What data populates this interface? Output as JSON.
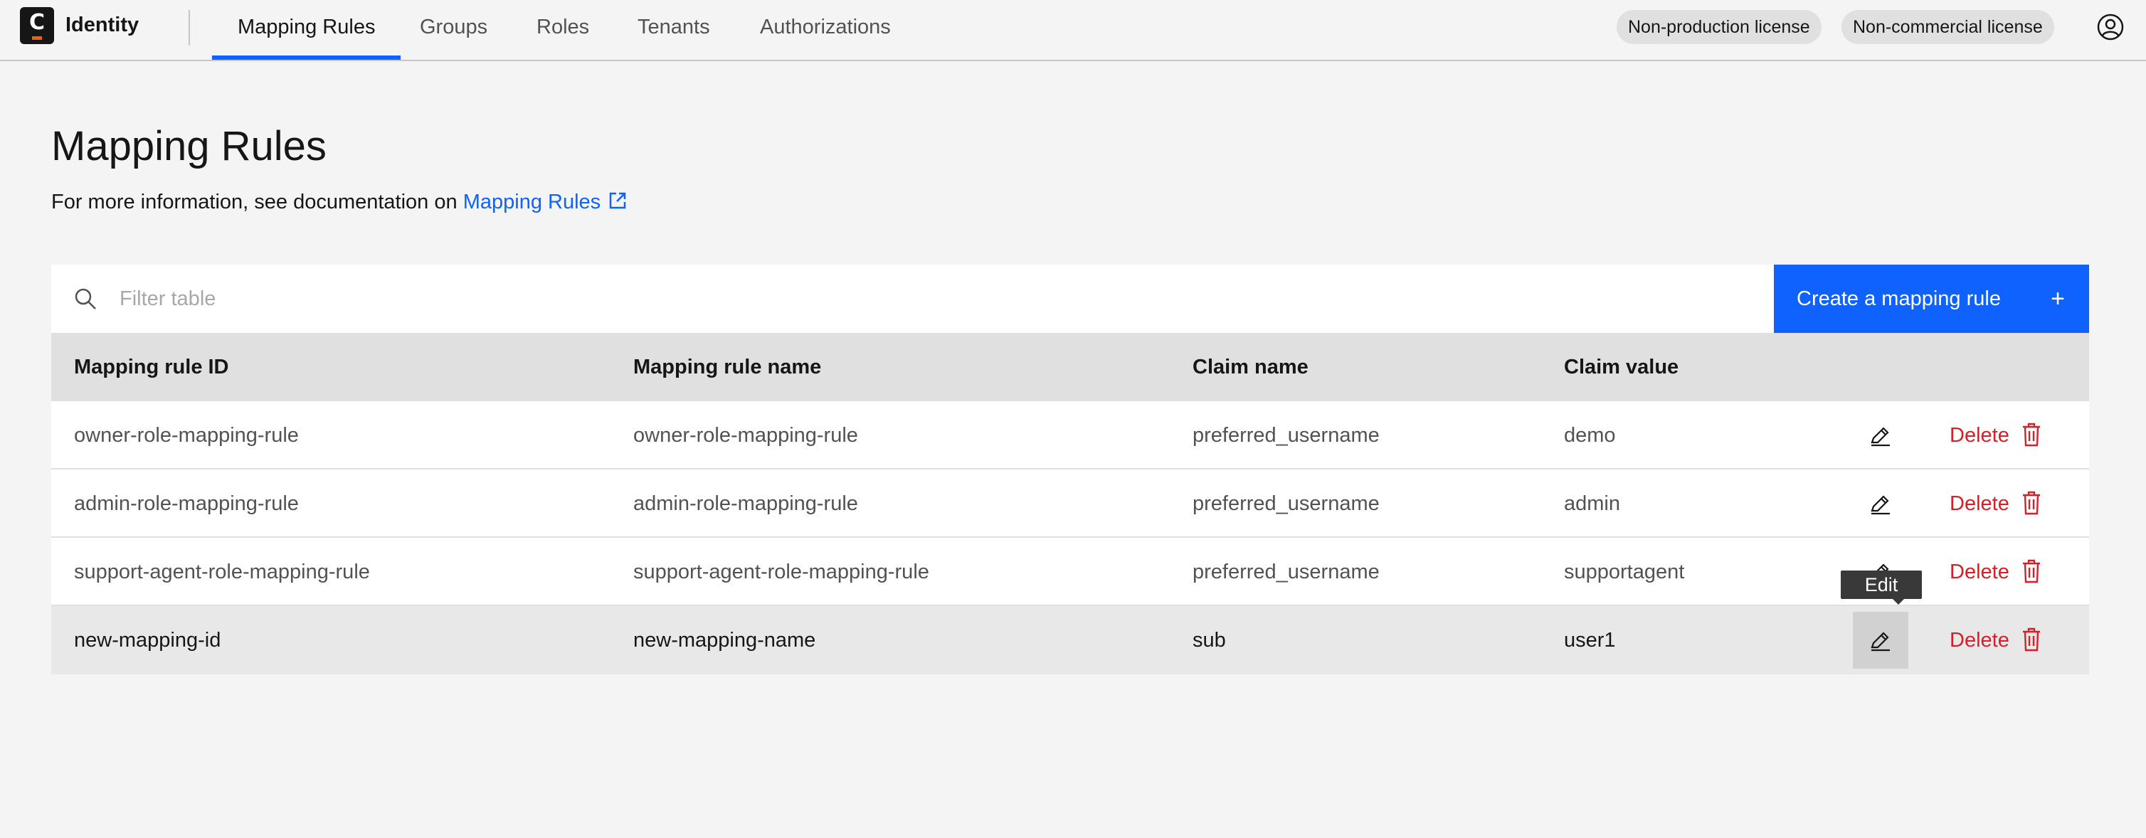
{
  "app": {
    "name": "Identity",
    "logo_letter": "C"
  },
  "nav": {
    "tabs": [
      {
        "label": "Mapping Rules",
        "active": true
      },
      {
        "label": "Groups",
        "active": false
      },
      {
        "label": "Roles",
        "active": false
      },
      {
        "label": "Tenants",
        "active": false
      },
      {
        "label": "Authorizations",
        "active": false
      }
    ]
  },
  "licenses": [
    "Non-production license",
    "Non-commercial license"
  ],
  "page": {
    "title": "Mapping Rules",
    "info_prefix": "For more information, see documentation on",
    "info_link": "Mapping Rules"
  },
  "toolbar": {
    "filter_placeholder": "Filter table",
    "create_label": "Create a mapping rule",
    "create_icon": "+"
  },
  "table": {
    "columns": [
      "Mapping rule ID",
      "Mapping rule name",
      "Claim name",
      "Claim value"
    ],
    "rows": [
      {
        "id": "owner-role-mapping-rule",
        "name": "owner-role-mapping-rule",
        "claim_name": "preferred_username",
        "claim_value": "demo",
        "delete_label": "Delete"
      },
      {
        "id": "admin-role-mapping-rule",
        "name": "admin-role-mapping-rule",
        "claim_name": "preferred_username",
        "claim_value": "admin",
        "delete_label": "Delete"
      },
      {
        "id": "support-agent-role-mapping-rule",
        "name": "support-agent-role-mapping-rule",
        "claim_name": "preferred_username",
        "claim_value": "supportagent",
        "delete_label": "Delete"
      },
      {
        "id": "new-mapping-id",
        "name": "new-mapping-name",
        "claim_name": "sub",
        "claim_value": "user1",
        "delete_label": "Delete"
      }
    ]
  },
  "tooltip": {
    "label": "Edit"
  },
  "colors": {
    "accent": "#0f62fe",
    "danger": "#da1e28",
    "background": "#f4f4f4",
    "header_row": "#e0e0e0"
  },
  "icons": [
    "camunda-logo-icon",
    "user-avatar-icon",
    "external-link-icon",
    "search-icon",
    "plus-icon",
    "edit-pencil-icon",
    "trash-icon"
  ]
}
